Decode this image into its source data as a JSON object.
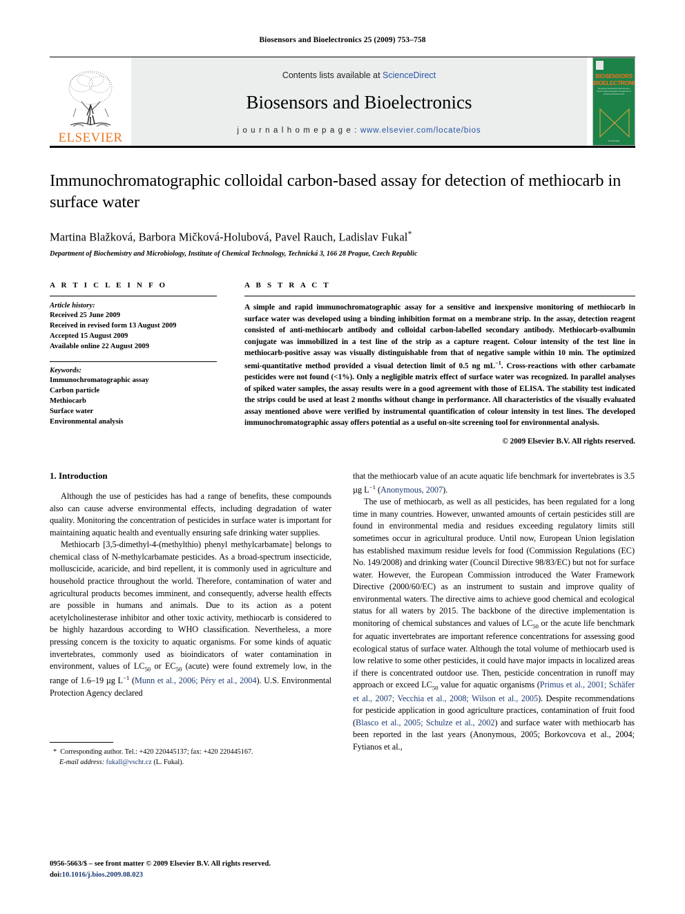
{
  "running_head": "Biosensors and Bioelectronics 25 (2009) 753–758",
  "masthead": {
    "publisher_logo_text": "ELSEVIER",
    "contents_prefix": "Contents lists available at ",
    "contents_link": "ScienceDirect",
    "journal_title": "Biosensors and Bioelectronics",
    "homepage_prefix": "j o u r n a l   h o m e p a g e :   ",
    "homepage_url": "www.elsevier.com/locate/bios",
    "cover": {
      "line1": "BIOSENSORS",
      "line2": "BIOELECTRONICS",
      "sub": "The principal international journal devoted to research, design development and application of biosensors and bioelectronics",
      "footer": "ELSEVIER",
      "bg_color": "#1c8248",
      "text_color": "#f07020"
    },
    "colors": {
      "elsevier_orange": "#E87722",
      "link_blue": "#2353a6",
      "band_gray": "#eceded"
    }
  },
  "article": {
    "title": "Immunochromatographic colloidal carbon-based assay for detection of methiocarb in surface water",
    "authors": "Martina Blažková, Barbora Mičková-Holubová, Pavel Rauch, Ladislav Fukal",
    "corresponding_marker": "*",
    "affiliation": "Department of Biochemistry and Microbiology, Institute of Chemical Technology, Technická 3, 166 28 Prague, Czech Republic"
  },
  "article_info": {
    "heading": "A R T I C L E   I N F O",
    "history_label": "Article history:",
    "history": [
      "Received 25 June 2009",
      "Received in revised form 13 August 2009",
      "Accepted 15 August 2009",
      "Available online 22 August 2009"
    ],
    "keywords_label": "Keywords:",
    "keywords": [
      "Immunochromatographic assay",
      "Carbon particle",
      "Methiocarb",
      "Surface water",
      "Environmental analysis"
    ]
  },
  "abstract": {
    "heading": "A B S T R A C T",
    "body": "A simple and rapid immunochromatographic assay for a sensitive and inexpensive monitoring of methiocarb in surface water was developed using a binding inhibition format on a membrane strip. In the assay, detection reagent consisted of anti-methiocarb antibody and colloidal carbon-labelled secondary antibody. Methiocarb-ovalbumin conjugate was immobilized in a test line of the strip as a capture reagent. Colour intensity of the test line in methiocarb-positive assay was visually distinguishable from that of negative sample within 10 min. The optimized semi-quantitative method provided a visual detection limit of 0.5 ng mL−1. Cross-reactions with other carbamate pesticides were not found (<1%). Only a negligible matrix effect of surface water was recognized. In parallel analyses of spiked water samples, the assay results were in a good agreement with those of ELISA. The stability test indicated the strips could be used at least 2 months without change in performance. All characteristics of the visually evaluated assay mentioned above were verified by instrumental quantification of colour intensity in test lines. The developed immunochromatographic assay offers potential as a useful on-site screening tool for environmental analysis.",
    "copyright": "© 2009 Elsevier B.V. All rights reserved."
  },
  "body": {
    "section_number_title": "1.  Introduction",
    "left_paragraphs": [
      "Although the use of pesticides has had a range of benefits, these compounds also can cause adverse environmental effects, including degradation of water quality. Monitoring the concentration of pesticides in surface water is important for maintaining aquatic health and eventually ensuring safe drinking water supplies.",
      "Methiocarb [3,5-dimethyl-4-(methylthio) phenyl methylcarbamate] belongs to chemical class of N-methylcarbamate pesticides. As a broad-spectrum insecticide, molluscicide, acaricide, and bird repellent, it is commonly used in agriculture and household practice throughout the world. Therefore, contamination of water and agricultural products becomes imminent, and consequently, adverse health effects are possible in humans and animals. Due to its action as a potent acetylcholinesterase inhibitor and other toxic activity, methiocarb is considered to be highly hazardous according to WHO classification. Nevertheless, a more pressing concern is the toxicity to aquatic organisms. For some kinds of aquatic invertebrates, commonly used as bioindicators of water contamination in environment, values of LC50 or EC50 (acute) were found extremely low, in the range of 1.6–19 µg L−1 (Munn et al., 2006; Péry et al., 2004). U.S. Environmental Protection Agency declared"
    ],
    "right_paragraphs": [
      "that the methiocarb value of an acute aquatic life benchmark for invertebrates is 3.5 µg L−1 (Anonymous, 2007).",
      "The use of methiocarb, as well as all pesticides, has been regulated for a long time in many countries. However, unwanted amounts of certain pesticides still are found in environmental media and residues exceeding regulatory limits still sometimes occur in agricultural produce. Until now, European Union legislation has established maximum residue levels for food (Commission Regulations (EC) No. 149/2008) and drinking water (Council Directive 98/83/EC) but not for surface water. However, the European Commission introduced the Water Framework Directive (2000/60/EC) as an instrument to sustain and improve quality of environmental waters. The directive aims to achieve good chemical and ecological status for all waters by 2015. The backbone of the directive implementation is monitoring of chemical substances and values of LC50 or the acute life benchmark for aquatic invertebrates are important reference concentrations for assessing good ecological status of surface water. Although the total volume of methiocarb used is low relative to some other pesticides, it could have major impacts in localized areas if there is concentrated outdoor use. Then, pesticide concentration in runoff may approach or exceed LC50 value for aquatic organisms (Primus et al., 2001; Schäfer et al., 2007; Vecchia et al., 2008; Wilson et al., 2005). Despite recommendations for pesticide application in good agriculture practices, contamination of fruit food (Blasco et al., 2005; Schulze et al., 2002) and surface water with methiocarb has been reported in the last years (Anonymous, 2005; Borkovcova et al., 2004; Fytianos et al.,"
    ],
    "citations_color": "#1b3a73"
  },
  "footnote": {
    "marker": "*",
    "line1": "Corresponding author. Tel.: +420 220445137; fax: +420 220445167.",
    "email_label": "E-mail address:",
    "email": "fukall@vscht.cz",
    "email_suffix": "(L. Fukal)."
  },
  "footer": {
    "line1": "0956-5663/$ – see front matter © 2009 Elsevier B.V. All rights reserved.",
    "doi_label": "doi:",
    "doi": "10.1016/j.bios.2009.08.023"
  }
}
